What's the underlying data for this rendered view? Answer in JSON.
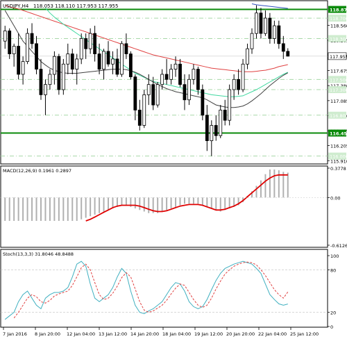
{
  "header": {
    "symbol": "USDJPY,H4",
    "ohlc": "118.053 118.110 117.953 117.955"
  },
  "colors": {
    "bull": "#ffffff",
    "bear": "#000000",
    "ma_red": "#e04040",
    "ma_blue": "#3050c0",
    "ma_cyan": "#40d8a0",
    "ma_dark": "#404040",
    "level_line": "#0a8a0a",
    "level_label_bg": "#0a8a0a",
    "macd_hist": "#b0b0b0",
    "macd_signal": "#e00000",
    "stoch_main": "#40b0c0",
    "stoch_signal": "#e04040"
  },
  "price_axis": {
    "ticks": [
      "118.560",
      "118.265",
      "117.970",
      "117.675",
      "117.380",
      "117.085",
      "116.790",
      "116.495",
      "116.205",
      "115.910"
    ],
    "range": [
      115.9,
      119.0
    ]
  },
  "levels": [
    {
      "value": "118.870",
      "style": "thick"
    },
    {
      "value": "118.700",
      "style": "dash"
    },
    {
      "value": "118.300",
      "style": "dash"
    },
    {
      "value": "117.955",
      "style": "current"
    },
    {
      "value": "117.500",
      "style": "dash"
    },
    {
      "value": "117.300",
      "style": "dash"
    },
    {
      "value": "116.800",
      "style": "dash"
    },
    {
      "value": "116.450",
      "style": "thick"
    },
    {
      "value": "116.000",
      "style": "dash"
    }
  ],
  "macd": {
    "label": "MACD(12,26,9) 0.1961 0.2897",
    "ticks": [
      "0.3778",
      "0.00",
      "-0.6126"
    ],
    "range": [
      -0.6126,
      0.3778
    ]
  },
  "stoch": {
    "label": "Stoch(13,3,3) 31.8046 48.8488",
    "ticks": [
      "100",
      "80",
      "20",
      "0"
    ]
  },
  "time_axis": {
    "labels": [
      "7 Jan 2016",
      "8 Jan 20:00",
      "12 Jan 04:00",
      "13 Jan 12:00",
      "14 Jan 20:00",
      "18 Jan 04:00",
      "19 Jan 12:00",
      "20 Jan 20:00",
      "22 Jan 04:00",
      "25 Jan 12:00"
    ]
  },
  "chart_data": {
    "type": "candlestick",
    "title": "USDJPY,H4",
    "price": {
      "ylim": [
        115.9,
        119.0
      ],
      "ohlc": [
        [
          118.25,
          118.55,
          118.1,
          118.45
        ],
        [
          118.45,
          118.5,
          117.9,
          118.0
        ],
        [
          118.0,
          118.2,
          117.75,
          118.15
        ],
        [
          118.15,
          118.4,
          117.5,
          117.6
        ],
        [
          117.6,
          117.95,
          117.4,
          117.85
        ],
        [
          117.85,
          118.5,
          117.8,
          118.4
        ],
        [
          118.4,
          118.6,
          118.1,
          118.2
        ],
        [
          118.2,
          118.35,
          117.6,
          117.7
        ],
        [
          117.7,
          117.9,
          117.1,
          117.2
        ],
        [
          117.2,
          117.5,
          116.8,
          117.4
        ],
        [
          117.4,
          117.7,
          117.3,
          117.6
        ],
        [
          117.6,
          118.05,
          117.4,
          117.95
        ],
        [
          117.95,
          118.0,
          117.2,
          117.3
        ],
        [
          117.3,
          117.9,
          117.2,
          117.8
        ],
        [
          117.8,
          118.2,
          117.6,
          118.0
        ],
        [
          118.0,
          118.1,
          117.6,
          117.7
        ],
        [
          117.7,
          118.0,
          117.4,
          117.9
        ],
        [
          117.9,
          118.4,
          117.8,
          118.3
        ],
        [
          118.3,
          118.4,
          117.9,
          118.1
        ],
        [
          118.1,
          118.5,
          118.0,
          118.4
        ],
        [
          118.4,
          118.55,
          117.85,
          118.0
        ],
        [
          118.0,
          118.2,
          117.6,
          117.7
        ],
        [
          117.7,
          118.1,
          117.5,
          118.05
        ],
        [
          118.05,
          118.25,
          117.75,
          117.8
        ],
        [
          117.8,
          118.05,
          117.6,
          117.9
        ],
        [
          117.9,
          118.1,
          117.55,
          117.6
        ],
        [
          117.6,
          118.25,
          117.55,
          118.2
        ],
        [
          118.2,
          118.4,
          117.9,
          118.0
        ],
        [
          118.0,
          118.05,
          117.5,
          117.55
        ],
        [
          117.55,
          117.6,
          116.7,
          116.9
        ],
        [
          116.9,
          117.1,
          116.5,
          116.6
        ],
        [
          116.6,
          117.3,
          116.55,
          117.2
        ],
        [
          117.2,
          117.6,
          117.0,
          117.4
        ],
        [
          117.4,
          117.55,
          116.9,
          117.0
        ],
        [
          117.0,
          117.45,
          116.95,
          117.4
        ],
        [
          117.4,
          117.7,
          117.3,
          117.6
        ],
        [
          117.6,
          117.9,
          117.4,
          117.5
        ],
        [
          117.5,
          117.8,
          117.4,
          117.7
        ],
        [
          117.7,
          117.95,
          117.55,
          117.8
        ],
        [
          117.8,
          117.9,
          117.35,
          117.4
        ],
        [
          117.4,
          117.6,
          116.9,
          117.1
        ],
        [
          117.1,
          117.6,
          117.0,
          117.5
        ],
        [
          117.5,
          117.8,
          117.4,
          117.7
        ],
        [
          117.7,
          117.75,
          117.2,
          117.3
        ],
        [
          117.3,
          117.4,
          116.7,
          116.8
        ],
        [
          116.8,
          117.0,
          116.1,
          116.3
        ],
        [
          116.3,
          116.7,
          116.0,
          116.6
        ],
        [
          116.6,
          116.8,
          116.3,
          116.4
        ],
        [
          116.4,
          117.0,
          116.35,
          116.9
        ],
        [
          116.9,
          117.1,
          116.6,
          116.7
        ],
        [
          116.7,
          117.4,
          116.6,
          117.3
        ],
        [
          117.3,
          117.6,
          117.1,
          117.5
        ],
        [
          117.5,
          117.7,
          117.2,
          117.3
        ],
        [
          117.3,
          117.9,
          117.25,
          117.8
        ],
        [
          117.8,
          118.2,
          117.7,
          118.1
        ],
        [
          118.1,
          118.5,
          118.0,
          118.4
        ],
        [
          118.4,
          118.95,
          118.3,
          118.8
        ],
        [
          118.8,
          118.9,
          118.3,
          118.4
        ],
        [
          118.4,
          118.85,
          118.35,
          118.7
        ],
        [
          118.7,
          118.8,
          118.2,
          118.3
        ],
        [
          118.3,
          118.65,
          118.2,
          118.55
        ],
        [
          118.55,
          118.65,
          118.1,
          118.2
        ],
        [
          118.2,
          118.35,
          117.9,
          118.05
        ],
        [
          118.05,
          118.11,
          117.95,
          117.955
        ]
      ],
      "moving_averages": [
        {
          "color": "ma_red",
          "values": [
            118.95,
            118.92,
            118.9,
            118.88,
            118.85,
            118.82,
            118.79,
            118.76,
            118.73,
            118.7,
            118.67,
            118.64,
            118.61,
            118.58,
            118.55,
            118.52,
            118.49,
            118.46,
            118.43,
            118.4,
            118.37,
            118.34,
            118.31,
            118.28,
            118.25,
            118.22,
            118.19,
            118.16,
            118.13,
            118.1,
            118.07,
            118.04,
            118.01,
            117.98,
            117.96,
            117.94,
            117.92,
            117.9,
            117.88,
            117.86,
            117.84,
            117.82,
            117.8,
            117.78,
            117.76,
            117.74,
            117.72,
            117.71,
            117.7,
            117.69,
            117.68,
            117.67,
            117.66,
            117.65,
            117.65,
            117.65,
            117.66,
            117.67,
            117.68,
            117.7,
            117.72,
            117.75,
            117.77,
            117.79
          ]
        },
        {
          "color": "ma_blue",
          "values": [
            null,
            null,
            null,
            null,
            null,
            null,
            null,
            null,
            null,
            null,
            null,
            null,
            null,
            null,
            null,
            null,
            null,
            null,
            null,
            null,
            null,
            null,
            null,
            null,
            null,
            null,
            null,
            null,
            null,
            null,
            null,
            null,
            null,
            null,
            null,
            null,
            null,
            null,
            null,
            null,
            null,
            null,
            null,
            null,
            null,
            null,
            null,
            null,
            null,
            null,
            null,
            null,
            null,
            null,
            null,
            118.98,
            118.96,
            118.95,
            118.94,
            118.93,
            118.92,
            118.91,
            118.9,
            118.89
          ]
        },
        {
          "color": "ma_cyan",
          "values": [
            null,
            null,
            null,
            null,
            null,
            null,
            null,
            null,
            null,
            118.9,
            118.8,
            118.72,
            118.65,
            118.58,
            118.52,
            118.46,
            118.4,
            118.34,
            118.28,
            118.22,
            118.16,
            118.1,
            118.04,
            117.98,
            117.92,
            117.86,
            117.8,
            117.74,
            117.68,
            117.62,
            117.58,
            117.54,
            117.5,
            117.46,
            117.44,
            117.42,
            117.4,
            117.38,
            117.36,
            117.34,
            117.32,
            117.3,
            117.28,
            117.26,
            117.24,
            117.22,
            117.2,
            117.19,
            117.18,
            117.17,
            117.16,
            117.16,
            117.17,
            117.18,
            117.22,
            117.26,
            117.3,
            117.35,
            117.4,
            117.45,
            117.5,
            117.55,
            117.6,
            117.64
          ]
        },
        {
          "color": "ma_dark",
          "values": [
            118.85,
            118.7,
            118.55,
            118.4,
            118.25,
            118.15,
            118.05,
            117.95,
            117.85,
            117.78,
            117.72,
            117.68,
            117.65,
            117.63,
            117.62,
            117.62,
            117.62,
            117.63,
            117.64,
            117.65,
            117.66,
            117.67,
            117.68,
            117.69,
            117.7,
            117.7,
            117.7,
            117.69,
            117.67,
            117.64,
            117.6,
            117.55,
            117.5,
            117.45,
            117.4,
            117.36,
            117.32,
            117.29,
            117.26,
            117.24,
            117.22,
            117.2,
            117.18,
            117.16,
            117.14,
            117.1,
            117.05,
            117.0,
            116.98,
            116.96,
            116.95,
            116.95,
            116.96,
            116.98,
            117.02,
            117.08,
            117.15,
            117.22,
            117.3,
            117.38,
            117.45,
            117.52,
            117.58,
            117.63
          ]
        }
      ]
    },
    "macd": {
      "ylim": [
        -0.6126,
        0.3778
      ],
      "histogram": [
        -0.3,
        -0.3,
        -0.3,
        -0.3,
        -0.3,
        -0.3,
        -0.3,
        -0.3,
        -0.3,
        -0.3,
        -0.3,
        -0.3,
        -0.3,
        -0.3,
        -0.3,
        -0.3,
        -0.3,
        -0.28,
        -0.26,
        -0.24,
        -0.22,
        -0.2,
        -0.18,
        -0.16,
        -0.14,
        -0.12,
        -0.1,
        -0.1,
        -0.12,
        -0.14,
        -0.16,
        -0.18,
        -0.2,
        -0.2,
        -0.2,
        -0.18,
        -0.16,
        -0.14,
        -0.12,
        -0.1,
        -0.08,
        -0.08,
        -0.08,
        -0.08,
        -0.1,
        -0.12,
        -0.14,
        -0.16,
        -0.18,
        -0.16,
        -0.14,
        -0.12,
        -0.1,
        -0.06,
        0.02,
        0.08,
        0.15,
        0.22,
        0.3,
        0.36,
        0.36,
        0.35,
        0.33,
        0.32
      ],
      "signal": [
        null,
        null,
        null,
        null,
        null,
        null,
        null,
        null,
        null,
        null,
        null,
        null,
        null,
        null,
        null,
        null,
        null,
        null,
        -0.3,
        -0.28,
        -0.25,
        -0.22,
        -0.19,
        -0.16,
        -0.13,
        -0.11,
        -0.1,
        -0.1,
        -0.1,
        -0.1,
        -0.11,
        -0.13,
        -0.15,
        -0.17,
        -0.18,
        -0.18,
        -0.17,
        -0.15,
        -0.13,
        -0.11,
        -0.1,
        -0.09,
        -0.09,
        -0.09,
        -0.1,
        -0.12,
        -0.14,
        -0.16,
        -0.16,
        -0.15,
        -0.13,
        -0.11,
        -0.08,
        -0.04,
        0.01,
        0.06,
        0.11,
        0.16,
        0.21,
        0.25,
        0.28,
        0.29,
        0.29,
        0.29
      ]
    },
    "stochastic": {
      "ylim": [
        0,
        100
      ],
      "main": [
        10,
        15,
        20,
        35,
        45,
        50,
        40,
        30,
        25,
        40,
        45,
        48,
        48,
        50,
        55,
        70,
        88,
        92,
        85,
        60,
        40,
        35,
        40,
        45,
        55,
        70,
        82,
        75,
        50,
        30,
        20,
        18,
        22,
        25,
        30,
        35,
        45,
        55,
        62,
        60,
        50,
        35,
        28,
        25,
        28,
        38,
        52,
        65,
        75,
        82,
        85,
        88,
        90,
        92,
        90,
        88,
        82,
        75,
        60,
        45,
        38,
        32,
        30,
        31.8
      ],
      "signal": [
        null,
        null,
        12,
        20,
        30,
        40,
        45,
        42,
        35,
        33,
        37,
        43,
        46,
        48,
        50,
        58,
        70,
        83,
        88,
        80,
        62,
        45,
        38,
        40,
        47,
        57,
        69,
        76,
        70,
        53,
        35,
        23,
        20,
        22,
        26,
        30,
        37,
        46,
        54,
        60,
        58,
        48,
        38,
        30,
        27,
        30,
        40,
        53,
        64,
        74,
        80,
        85,
        88,
        90,
        91,
        90,
        87,
        80,
        72,
        62,
        52,
        45,
        40,
        48.8
      ]
    }
  }
}
